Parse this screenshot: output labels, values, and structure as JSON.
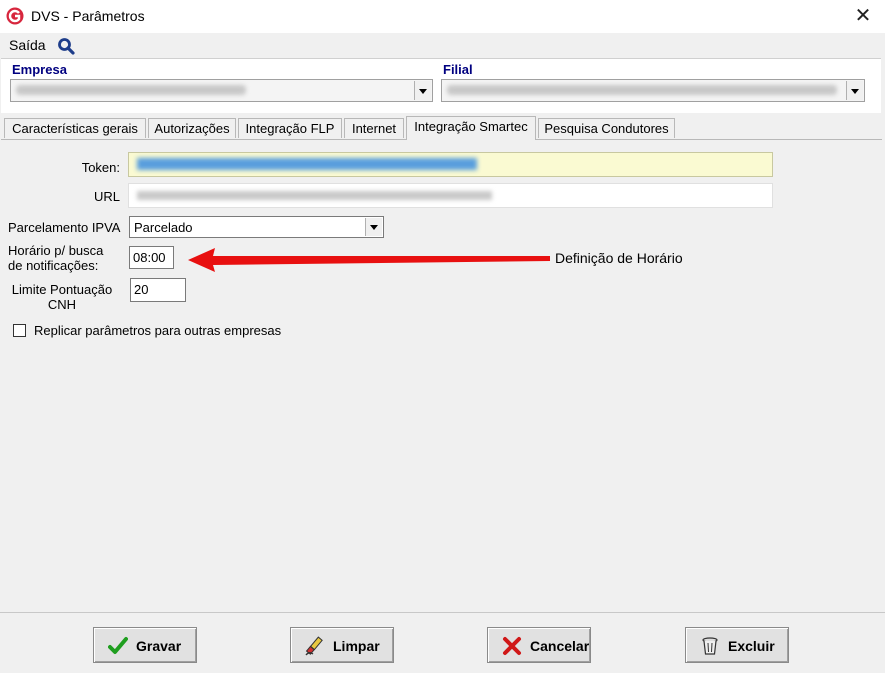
{
  "window": {
    "title": "DVS - Parâmetros",
    "close_glyph": "✕"
  },
  "menu": {
    "saida_label": "Saída"
  },
  "company": {
    "empresa_label": "Empresa",
    "filial_label": "Filial"
  },
  "tabs": [
    {
      "label": "Características gerais"
    },
    {
      "label": "Autorizações"
    },
    {
      "label": "Integração FLP"
    },
    {
      "label": "Internet"
    },
    {
      "label": "Integração Smartec"
    },
    {
      "label": "Pesquisa Condutores"
    }
  ],
  "form": {
    "token_label": "Token:",
    "url_label": "URL",
    "ipva_label": "Parcelamento IPVA",
    "ipva_value": "Parcelado",
    "horario_label_line1": "Horário p/ busca",
    "horario_label_line2": "de notificações:",
    "horario_value": "08:00",
    "limite_label_line1": "Limite Pontuação",
    "limite_label_line2": "CNH",
    "limite_value": "20",
    "replicar_label": "Replicar parâmetros para outras empresas"
  },
  "annotation": {
    "text": "Definição de Horário",
    "arrow_color": "#e81010"
  },
  "buttons": {
    "gravar_label": "Gravar",
    "limpar_label": "Limpar",
    "cancelar_label": "Cancelar",
    "excluir_label": "Excluir"
  },
  "colors": {
    "token_bg": "#fafad2",
    "label_blue": "#000080",
    "logo_red": "#d7263d"
  }
}
